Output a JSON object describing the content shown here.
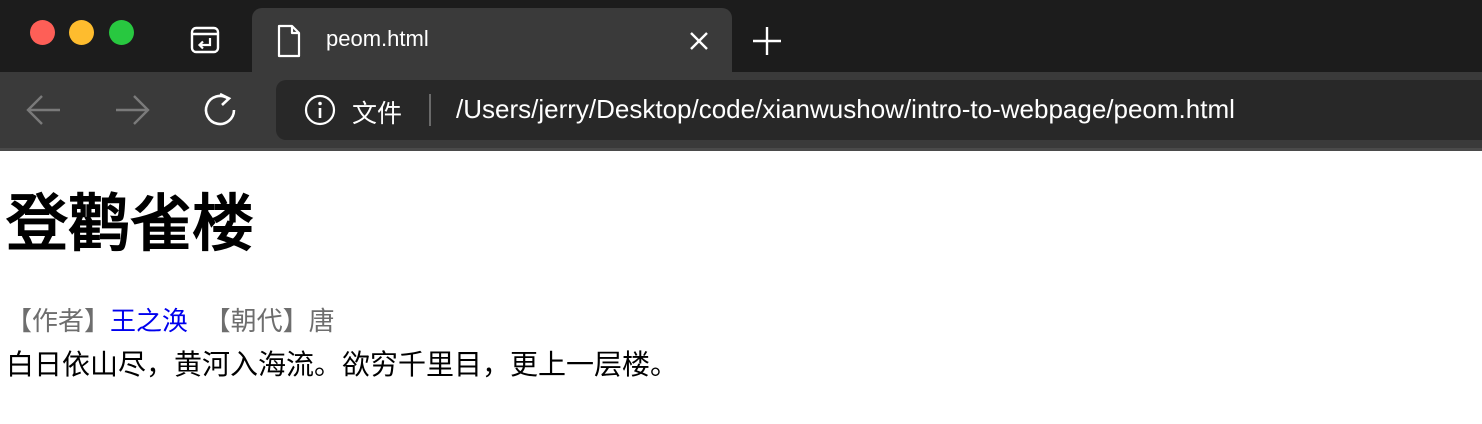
{
  "window": {
    "traffic_lights": {
      "close": "#fe5f57",
      "minimize": "#febc2e",
      "zoom": "#28c840"
    }
  },
  "tabs": [
    {
      "title": "peom.html",
      "icon": "page-icon",
      "active": true
    }
  ],
  "tabbar": {
    "tab_actions_icon": "tab-actions-icon",
    "new_tab_icon": "plus-icon",
    "close_icon": "close-icon"
  },
  "toolbar": {
    "back_icon": "arrow-left-icon",
    "forward_icon": "arrow-right-icon",
    "reload_icon": "reload-icon",
    "security_icon": "info-icon",
    "security_label": "文件",
    "url": "/Users/jerry/Desktop/code/xianwushow/intro-to-webpage/peom.html"
  },
  "page": {
    "title": "登鹳雀楼",
    "author_label": "【作者】",
    "author": "王之涣",
    "dynasty_label": "【朝代】",
    "dynasty": "唐",
    "poem": "白日依山尽，黄河入海流。欲穷千里目，更上一层楼。",
    "colors": {
      "link": "#0000ee",
      "meta": "#6e6e6e",
      "text": "#000000"
    }
  }
}
